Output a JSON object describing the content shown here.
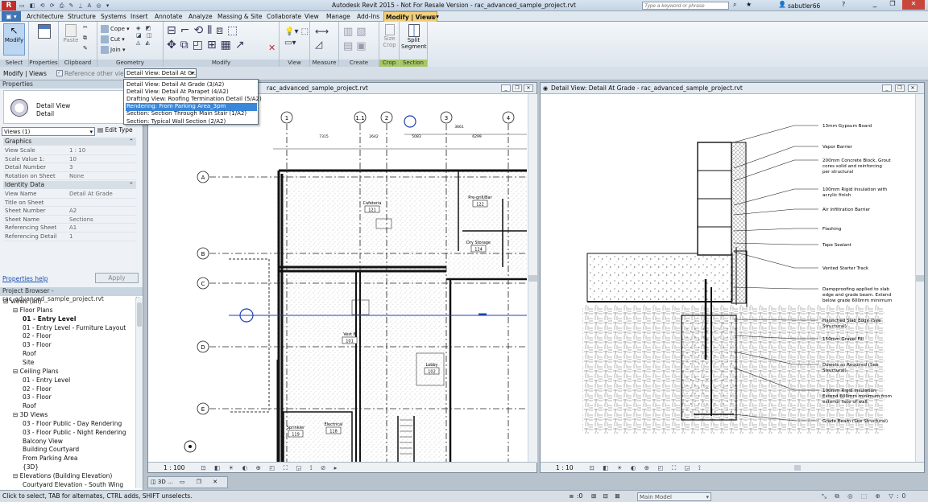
{
  "app": {
    "title": "Autodesk Revit 2015 - Not For Resale Version -",
    "file": "rac_advanced_sample_project.rvt",
    "search_placeholder": "Type a keyword or phrase",
    "user": "sabutler66"
  },
  "tabs": [
    "Architecture",
    "Structure",
    "Systems",
    "Insert",
    "Annotate",
    "Analyze",
    "Massing & Site",
    "Collaborate",
    "View",
    "Manage",
    "Add-Ins",
    "Modify | Views"
  ],
  "ribbon": {
    "modify": "Modify",
    "select": "Select",
    "properties": "Properties",
    "paste": "Paste",
    "clipboard": "Clipboard",
    "cope": "Cope",
    "cut": "Cut",
    "join": "Join",
    "geometry": "Geometry",
    "modify_panel": "Modify",
    "view": "View",
    "measure": "Measure",
    "create": "Create",
    "size_crop": "Size Crop",
    "crop": "Crop",
    "split_segment": "Split Segment",
    "section": "Section"
  },
  "options": {
    "context": "Modify | Views",
    "checkbox_label": "Reference other view:",
    "dropdown_value": "Detail View: Detail At Gr..."
  },
  "dropdown_items": [
    "Detail View: Detail At Grade (3/A2)",
    "Detail View: Detail At Parapet (4/A2)",
    "Drafting View: Roofing Termination Detail (5/A2)",
    "Rendering: From Parking Area_3pm",
    "Section: Section Through Main Stair (1/A2)",
    "Section: Typical Wall Section (2/A2)"
  ],
  "properties": {
    "header": "Properties",
    "type_name": "Detail View",
    "type_sub": "Detail",
    "selector": "Views (1)",
    "edit_type": "Edit Type",
    "groups": {
      "graphics": "Graphics",
      "identity": "Identity Data"
    },
    "graphics_rows": [
      [
        "View Scale",
        "1 : 10"
      ],
      [
        "Scale Value    1:",
        "10"
      ],
      [
        "Detail Number",
        "3"
      ],
      [
        "Rotation on Sheet",
        "None"
      ]
    ],
    "identity_rows": [
      [
        "View Name",
        "Detail At Grade"
      ],
      [
        "Title on Sheet",
        ""
      ],
      [
        "Sheet Number",
        "A2"
      ],
      [
        "Sheet Name",
        "Sections"
      ],
      [
        "Referencing Sheet",
        "A1"
      ],
      [
        "Referencing Detail",
        "1"
      ]
    ],
    "help": "Properties help",
    "apply": "Apply"
  },
  "browser": {
    "header": "Project Browser - rac_advanced_sample_project.rvt",
    "nodes": [
      {
        "label": "Views (all)",
        "indent": 0,
        "sel": false
      },
      {
        "label": "Floor Plans",
        "indent": 1,
        "sel": false
      },
      {
        "label": "01 - Entry Level",
        "indent": 2,
        "sel": true
      },
      {
        "label": "01 - Entry Level - Furniture Layout",
        "indent": 2,
        "sel": false
      },
      {
        "label": "02 - Floor",
        "indent": 2,
        "sel": false
      },
      {
        "label": "03 - Floor",
        "indent": 2,
        "sel": false
      },
      {
        "label": "Roof",
        "indent": 2,
        "sel": false
      },
      {
        "label": "Site",
        "indent": 2,
        "sel": false
      },
      {
        "label": "Ceiling Plans",
        "indent": 1,
        "sel": false
      },
      {
        "label": "01 - Entry Level",
        "indent": 2,
        "sel": false
      },
      {
        "label": "02 - Floor",
        "indent": 2,
        "sel": false
      },
      {
        "label": "03 - Floor",
        "indent": 2,
        "sel": false
      },
      {
        "label": "Roof",
        "indent": 2,
        "sel": false
      },
      {
        "label": "3D Views",
        "indent": 1,
        "sel": false
      },
      {
        "label": "03 - Floor Public - Day Rendering",
        "indent": 2,
        "sel": false
      },
      {
        "label": "03 - Floor Public - Night Rendering",
        "indent": 2,
        "sel": false
      },
      {
        "label": "Balcony View",
        "indent": 2,
        "sel": false
      },
      {
        "label": "Building Courtyard",
        "indent": 2,
        "sel": false
      },
      {
        "label": "From Parking Area",
        "indent": 2,
        "sel": false
      },
      {
        "label": "{3D}",
        "indent": 2,
        "sel": false
      },
      {
        "label": "Elevations (Building Elevation)",
        "indent": 1,
        "sel": false
      },
      {
        "label": "Courtyard Elevation - South Wing",
        "indent": 2,
        "sel": false
      }
    ]
  },
  "view1": {
    "title": "rac_advanced_sample_project.rvt",
    "scale": "1 : 100",
    "grid_cols": [
      "1",
      "1.1",
      "2",
      "3",
      "4"
    ],
    "grid_rows": [
      "A",
      "B",
      "C",
      "D",
      "E"
    ],
    "rooms": [
      {
        "name": "Cafeteria",
        "num": "121"
      },
      {
        "name": "Pre-grill/Bar",
        "num": "122"
      },
      {
        "name": "Dry Storage",
        "num": "124"
      },
      {
        "name": "Vest 6",
        "num": "101"
      },
      {
        "name": "Lobby",
        "num": "102"
      },
      {
        "name": "Electrical",
        "num": "118"
      },
      {
        "name": "Sprinkler",
        "num": "119"
      }
    ],
    "dims": [
      "7315",
      "2642",
      "5083",
      "6299",
      "3661"
    ]
  },
  "view2": {
    "title": "Detail View: Detail At Grade - rac_advanced_sample_project.rvt",
    "scale": "1 : 10",
    "notes": [
      "13mm Gypsum Board",
      "Vapor Barrier",
      "200mm Concrete Block, Grout cores solid and reinforcing per structural",
      "100mm Rigid Insulation with acrylic finish",
      "Air Infiltration Barrier",
      "Flashing",
      "Tape Sealant",
      "Vented Starter Track",
      "Dampproofing applied to slab edge and grade beam. Extend below grade 600mm minimum",
      "Haunched Slab Edge (See Structural)",
      "150mm Gravel Fill",
      "Dowels as Required (See Structural)",
      "100mm Rigid Insulation Extend 600mm minimum from exterior face of wall.",
      "Grade Beam (See Structural)"
    ]
  },
  "wintab": "3D ...",
  "status": {
    "hint": "Click to select, TAB for alternates, CTRL adds, SHIFT unselects.",
    "zero": ":0",
    "model": "Main Model"
  },
  "colors": {
    "accent": "#f2d17a",
    "highlight": "#3a86d8",
    "green": "#a6c766",
    "selection": "#1f3fb5"
  }
}
